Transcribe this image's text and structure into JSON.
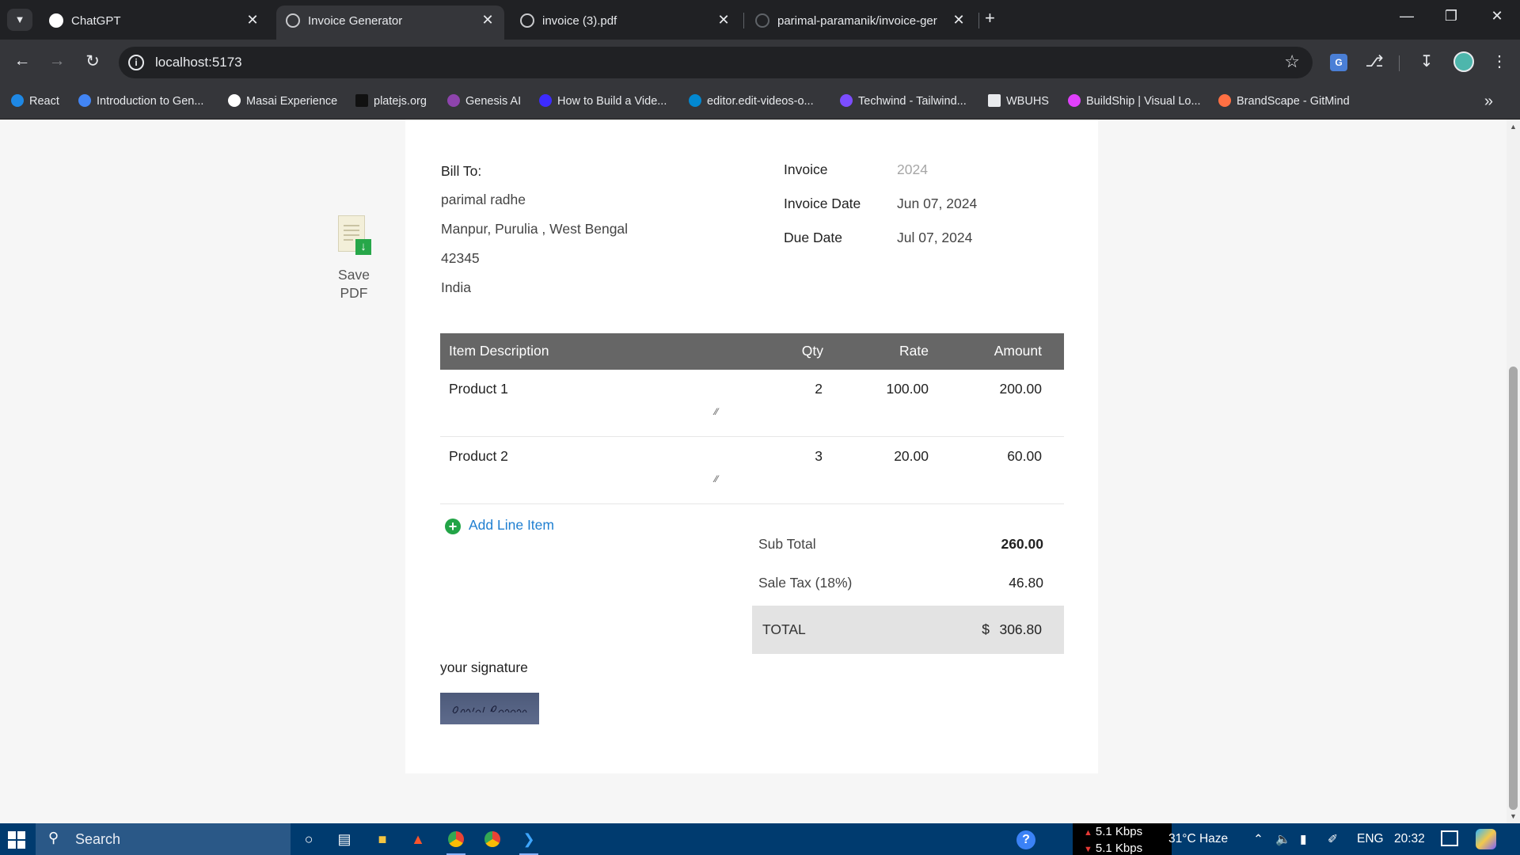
{
  "browser": {
    "tabs": [
      {
        "title": "ChatGPT",
        "active": false
      },
      {
        "title": "Invoice Generator",
        "active": true
      },
      {
        "title": "invoice (3).pdf",
        "active": false
      },
      {
        "title": "parimal-paramanik/invoice-ger",
        "active": false
      }
    ],
    "url": "localhost:5173",
    "bookmarks": [
      "React",
      "Introduction to Gen...",
      "Masai Experience",
      "platejs.org",
      "Genesis AI",
      "How to Build a Vide...",
      "editor.edit-videos-o...",
      "Techwind - Tailwind...",
      "WBUHS",
      "BuildShip | Visual Lo...",
      "BrandScape - GitMind"
    ]
  },
  "save_pdf": {
    "label": "Save PDF"
  },
  "invoice": {
    "bill_to_heading": "Bill To:",
    "bill_to": {
      "name": "parimal radhe",
      "address": "Manpur, Purulia , West Bengal",
      "zip": "42345",
      "country": "India"
    },
    "meta": {
      "invoice_label": "Invoice",
      "invoice_placeholder": "2024",
      "invoice_date_label": "Invoice Date",
      "invoice_date": "Jun 07, 2024",
      "due_date_label": "Due Date",
      "due_date": "Jul 07, 2024"
    },
    "columns": {
      "description": "Item Description",
      "qty": "Qty",
      "rate": "Rate",
      "amount": "Amount"
    },
    "items": [
      {
        "description": "Product 1",
        "qty": "2",
        "rate": "100.00",
        "amount": "200.00"
      },
      {
        "description": "Product 2",
        "qty": "3",
        "rate": "20.00",
        "amount": "60.00"
      }
    ],
    "add_line_item": "Add Line Item",
    "totals": {
      "subtotal_label": "Sub Total",
      "subtotal": "260.00",
      "tax_label": "Sale Tax (18%)",
      "tax": "46.80",
      "total_label": "TOTAL",
      "currency": "$",
      "total": "306.80"
    },
    "signature_label": "your signature",
    "signature_text": "Parimal Paramanik"
  },
  "taskbar": {
    "search": "Search",
    "net_up": "5.1 Kbps",
    "net_down": "5.1 Kbps",
    "weather": "31°C  Haze",
    "language": "ENG",
    "time": "20:32"
  },
  "colors": {
    "table_header": "#666666",
    "add_link": "#1f7fd1",
    "add_icon": "#22a447",
    "total_bg": "#e3e3e3",
    "taskbar": "#003b6f"
  }
}
